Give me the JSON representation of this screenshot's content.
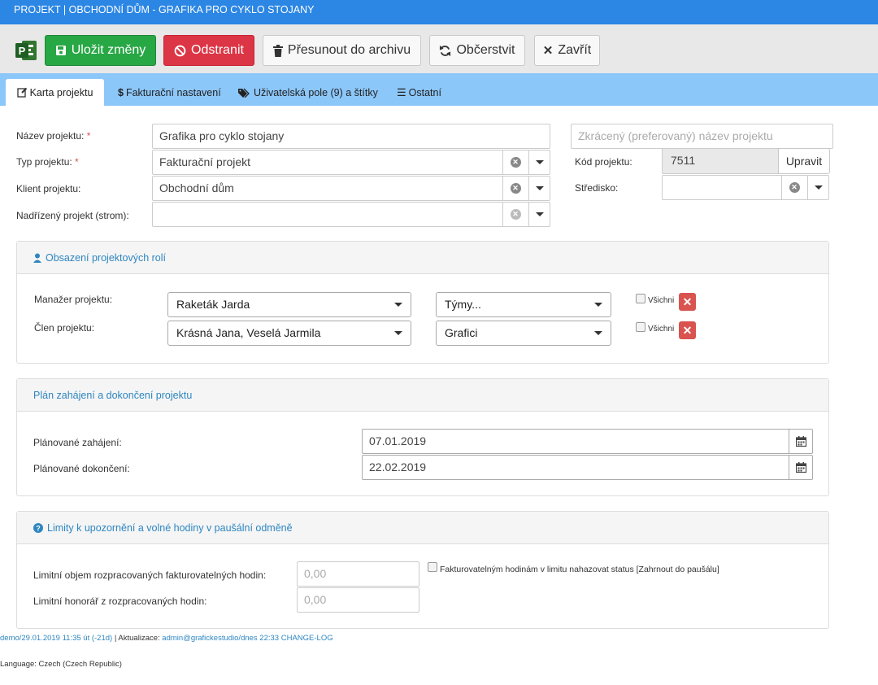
{
  "window": {
    "title": "PROJEKT | OBCHODNÍ DŮM - GRAFIKA PRO CYKLO STOJANY"
  },
  "toolbar": {
    "save_label": "Uložit změny",
    "delete_label": "Odstranit",
    "archive_label": "Přesunout do archivu",
    "refresh_label": "Občerstvit",
    "close_label": "Zavřít"
  },
  "tabs": [
    {
      "label": "Karta projektu",
      "active": true
    },
    {
      "label": "Fakturační nastavení"
    },
    {
      "label": "Uživatelská pole (9) a štítky"
    },
    {
      "label": "Ostatní"
    }
  ],
  "form": {
    "name_label": "Název projektu:",
    "name_value": "Grafika pro cyklo stojany",
    "short_name_placeholder": "Zkrácený (preferovaný) název projektu",
    "type_label": "Typ projektu:",
    "type_value": "Fakturační projekt",
    "client_label": "Klient projektu:",
    "client_value": "Obchodní dům",
    "parent_label": "Nadřízený projekt (strom):",
    "parent_value": "",
    "code_label": "Kód projektu:",
    "code_value": "7511",
    "code_edit_label": "Upravit",
    "center_label": "Středisko:",
    "center_value": ""
  },
  "roles": {
    "title": "Obsazení projektových rolí",
    "manager_label": "Manažer projektu:",
    "manager_value": "Raketák Jarda",
    "manager_team": "Týmy...",
    "member_label": "Člen projektu:",
    "member_value": "Krásná Jana, Veselá Jarmila",
    "member_team": "Grafici",
    "all_label": "Všichni"
  },
  "plan": {
    "title": "Plán zahájení a dokončení projektu",
    "start_label": "Plánované zahájení:",
    "start_value": "07.01.2019",
    "end_label": "Plánované dokončení:",
    "end_value": "22.02.2019"
  },
  "limits": {
    "title": "Limity k upozornění a volné hodiny v paušální odměně",
    "hours_label": "Limitní objem rozpracovaných fakturovatelných hodin:",
    "hours_value": "0,00",
    "fee_label": "Limitní honorář z rozpracovaných hodin:",
    "fee_value": "0,00",
    "checkbox_label": "Fakturovatelným hodinám v limitu nahazovat status [Zahrnout do paušálu]"
  },
  "footer": {
    "created": "demo/29.01.2019 11:35 út (-21d)",
    "separator": " | Aktualizace: ",
    "updated": "admin@grafickestudio/dnes 22:33",
    "changelog": "CHANGE-LOG",
    "language": "Language: Czech (Czech Republic)"
  },
  "colors": {
    "titlebar": "#2b86e4",
    "tabbar": "#8cc7fa",
    "success": "#28a745",
    "danger": "#dc3545",
    "link": "#2e86c1"
  }
}
